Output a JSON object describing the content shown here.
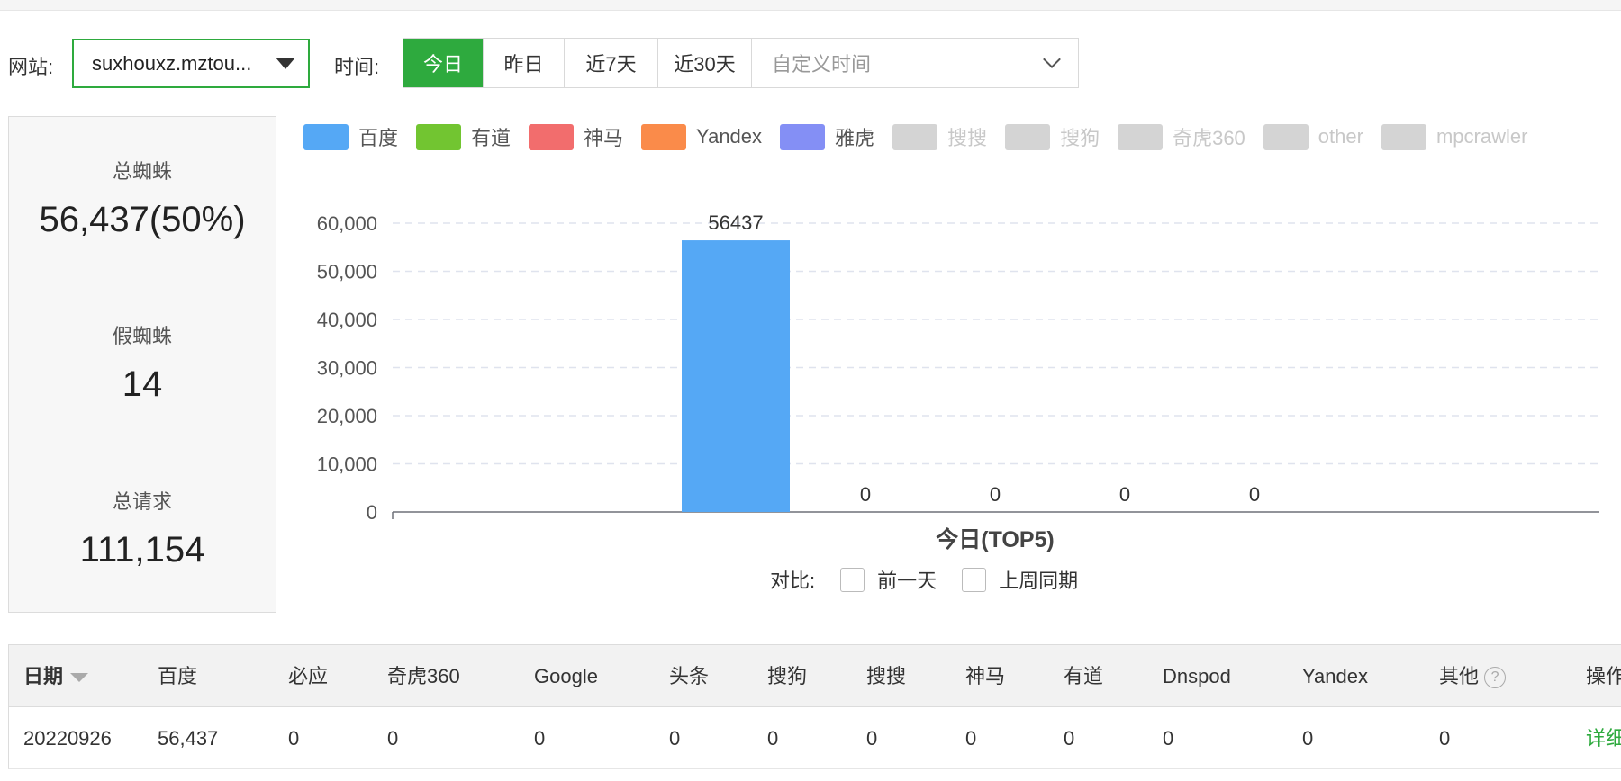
{
  "filters": {
    "site_label": "网站:",
    "site_value": "suxhouxz.mztou...",
    "time_label": "时间:",
    "time_options": [
      "今日",
      "昨日",
      "近7天",
      "近30天"
    ],
    "time_active": 0,
    "custom_time_placeholder": "自定义时间"
  },
  "stats": [
    {
      "label": "总蜘蛛",
      "value": "56,437(50%)"
    },
    {
      "label": "假蜘蛛",
      "value": "14"
    },
    {
      "label": "总请求",
      "value": "111,154"
    }
  ],
  "colors": {
    "accent": "#2eaa3e",
    "bar": "#55a8f5"
  },
  "legend": [
    {
      "name": "百度",
      "color": "#55a8f5",
      "active": true
    },
    {
      "name": "有道",
      "color": "#72c531",
      "active": true
    },
    {
      "name": "神马",
      "color": "#f26d6d",
      "active": true
    },
    {
      "name": "Yandex",
      "color": "#fa8b4a",
      "active": true
    },
    {
      "name": "雅虎",
      "color": "#848ff5",
      "active": true
    },
    {
      "name": "搜搜",
      "color": "#d4d4d4",
      "active": false
    },
    {
      "name": "搜狗",
      "color": "#d4d4d4",
      "active": false
    },
    {
      "name": "奇虎360",
      "color": "#d4d4d4",
      "active": false
    },
    {
      "name": "other",
      "color": "#d4d4d4",
      "active": false
    },
    {
      "name": "mpcrawler",
      "color": "#d4d4d4",
      "active": false
    }
  ],
  "chart_data": {
    "type": "bar",
    "title": "今日(TOP5)",
    "categories": [
      "百度",
      "有道",
      "神马",
      "Yandex",
      "雅虎"
    ],
    "values": [
      56437,
      0,
      0,
      0,
      0
    ],
    "ylim": [
      0,
      60000
    ],
    "yticks": [
      "0",
      "10,000",
      "20,000",
      "30,000",
      "40,000",
      "50,000",
      "60,000"
    ],
    "grid": true,
    "legend_position": "top"
  },
  "compare": {
    "label": "对比:",
    "options": [
      "前一天",
      "上周同期"
    ]
  },
  "table": {
    "columns": [
      "日期",
      "百度",
      "必应",
      "奇虎360",
      "Google",
      "头条",
      "搜狗",
      "搜搜",
      "神马",
      "有道",
      "Dnspod",
      "Yandex",
      "其他",
      "操作"
    ],
    "help_glyph": "?",
    "rows": [
      [
        "20220926",
        "56,437",
        "0",
        "0",
        "0",
        "0",
        "0",
        "0",
        "0",
        "0",
        "0",
        "0",
        "0",
        "详细"
      ]
    ]
  }
}
